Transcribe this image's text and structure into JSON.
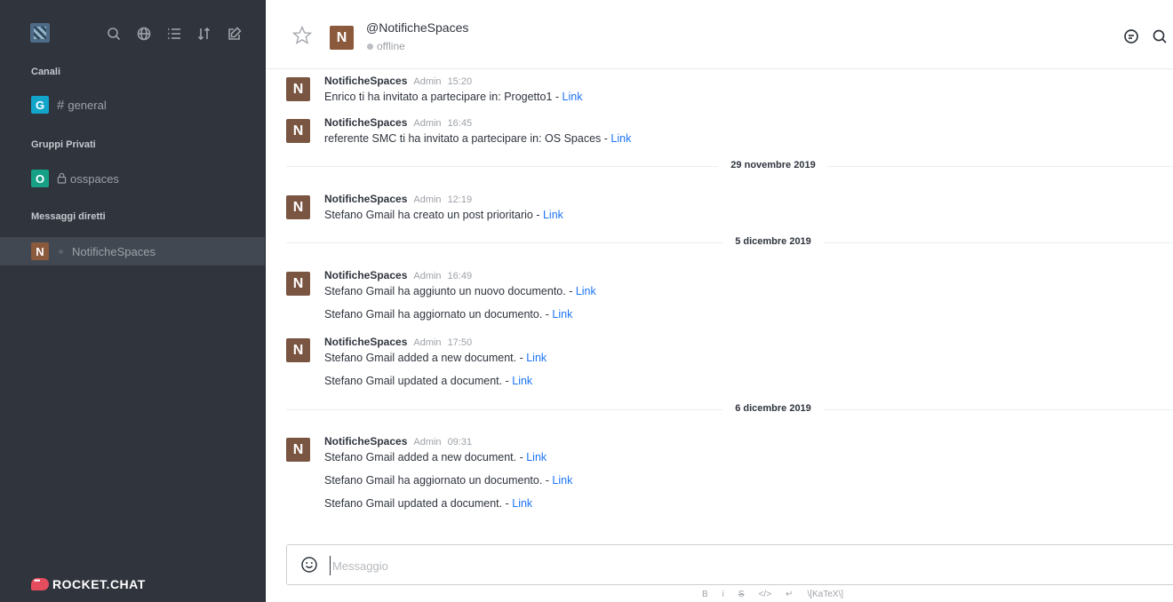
{
  "sidebar": {
    "sections": {
      "channels": "Canali",
      "private_groups": "Gruppi Privati",
      "direct_messages": "Messaggi diretti"
    },
    "channels": [
      {
        "avatar": "G",
        "symbol": "#",
        "label": "general",
        "color": "#12a4c9"
      }
    ],
    "groups": [
      {
        "avatar": "O",
        "symbol": "🔒",
        "label": "osspaces",
        "color": "#16a085"
      }
    ],
    "direct": [
      {
        "avatar": "N",
        "label": "NotificheSpaces",
        "color": "#8b5a3c"
      }
    ],
    "brand": "ROCKET.CHAT"
  },
  "header": {
    "avatar": "N",
    "room_name": "@NotificheSpaces",
    "status": "offline"
  },
  "messages": [
    {
      "user": "NotificheSpaces",
      "role": "Admin",
      "time": "15:20",
      "lines": [
        {
          "text": "Enrico ti ha invitato a partecipare in: Progetto1 - ",
          "link": "Link"
        }
      ]
    },
    {
      "user": "NotificheSpaces",
      "role": "Admin",
      "time": "16:45",
      "lines": [
        {
          "text": "referente SMC ti ha invitato a partecipare in: OS Spaces - ",
          "link": "Link"
        }
      ]
    },
    {
      "date": "29 novembre 2019"
    },
    {
      "user": "NotificheSpaces",
      "role": "Admin",
      "time": "12:19",
      "lines": [
        {
          "text": "Stefano Gmail ha creato un post prioritario - ",
          "link": "Link"
        }
      ]
    },
    {
      "date": "5 dicembre 2019"
    },
    {
      "user": "NotificheSpaces",
      "role": "Admin",
      "time": "16:49",
      "lines": [
        {
          "text": "Stefano Gmail ha aggiunto un nuovo documento. - ",
          "link": "Link"
        },
        {
          "text": "Stefano Gmail ha aggiornato un documento. - ",
          "link": "Link"
        }
      ]
    },
    {
      "user": "NotificheSpaces",
      "role": "Admin",
      "time": "17:50",
      "lines": [
        {
          "text": "Stefano Gmail added a new document. - ",
          "link": "Link"
        },
        {
          "text": "Stefano Gmail updated a document. - ",
          "link": "Link"
        }
      ]
    },
    {
      "date": "6 dicembre 2019"
    },
    {
      "user": "NotificheSpaces",
      "role": "Admin",
      "time": "09:31",
      "lines": [
        {
          "text": "Stefano Gmail added a new document. - ",
          "link": "Link"
        },
        {
          "text": "Stefano Gmail ha aggiornato un documento. - ",
          "link": "Link"
        },
        {
          "text": "Stefano Gmail updated a document. - ",
          "link": "Link"
        }
      ]
    }
  ],
  "composer": {
    "placeholder": "Messaggio",
    "format_buttons": [
      "B",
      "i",
      "S",
      "</>",
      "↵",
      "\\[KaTeX\\]"
    ]
  }
}
